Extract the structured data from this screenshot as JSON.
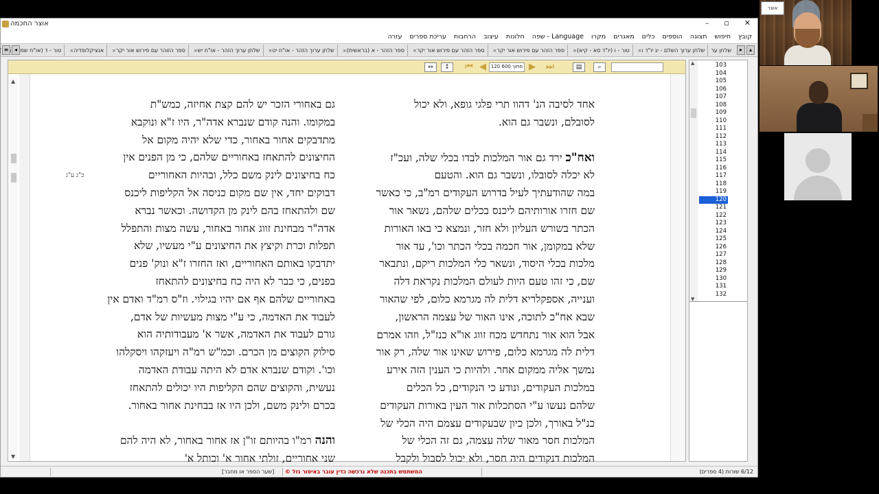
{
  "window": {
    "title": "אוצר החכמה",
    "minimize": "–",
    "restore": "▫",
    "close": "✕"
  },
  "menu": [
    "קובץ",
    "חיפוש",
    "תצוגה",
    "הוספים",
    "כלים",
    "מאגרים",
    "מקרו",
    "Language - שפה",
    "חלונות",
    "עיצוב",
    "הרחבות",
    "עריכת ספרים",
    "עזרה"
  ],
  "tabs": [
    "אנציקלופדיה",
    "ספר הזוהר עם פירוש אור יקר",
    "שלחן ערוך הזהר - או\"ח יש",
    "שלחן ערוך הזהר - או\"ח יט",
    "ספר הזהר - א (בראשית)",
    "ספר הזהר עם פירוש אור יקר",
    "ספר הזהר עם פירוש אור יקר",
    "טור - ו (יו\"ד סא - קיא)",
    "שלחן ערוך השלם - יג יו\"ד ו",
    "שלחן ער"
  ],
  "tabs_first": "טור - ד (או\"ח שמה - תצד)",
  "toolbar": {
    "page_field": "120 מתוך 600"
  },
  "text": {
    "right_column": [
      {
        "t": "אחד לסיבה הנ' דהוו תרי פלגי גופא, ולא יכול"
      },
      {
        "t": "לסובלם, ונשבר גם הוא."
      },
      {
        "t": ""
      },
      {
        "t": "ואח\"כ ירד גם אור המלכות לבדו בכלי שלה, ועכ\"ז",
        "lead": "ואח\"כ"
      },
      {
        "t": "לא יכלה לסובלו, ונשבר גם הוא. והטעם"
      },
      {
        "t": "במה שהודעתיך לעיל בדרוש העקודים רמ\"ב, כי כאשר"
      },
      {
        "t": "שם חזרו אורותיהם ליכנס בכלים שלהם, נשאר אור"
      },
      {
        "t": "הכתר בשורש העליון ולא חזר, ונמצא כי באו האורות"
      },
      {
        "t": "שלא במקומן, אור חכמה בכלי הכתר וכו', עד אור"
      },
      {
        "t": "מלכות בכלי היסוד, ונשאר כלי המלכות ריקם, ונתבאר"
      },
      {
        "t": "שם, כי זהו טעם היות לעולם המלכות נקראת דלה"
      },
      {
        "t": "וענייה, אספקלריא דלית לה מגרמא כלום, לפי שהאור"
      },
      {
        "t": "שבא אח\"כ לתוכה, אינו האור של עצמה הראשון,"
      },
      {
        "t": "אבל הוא אור נתחדש מכח זווג או\"א כנז\"ל, וזהו אמרם"
      },
      {
        "t": "דלית לה מגרמא כלום, פירוש שאינו אור שלה, רק אור"
      },
      {
        "t": "נמשך אליה ממקום אחר. ולהיות כי הענין הזה אירע"
      },
      {
        "t": "במלכות העקודים, ונודע כי הנקודים, כל הכלים"
      },
      {
        "t": "שלהם נעשו ע\"י הסתכלות אור העין באורות העקודים"
      },
      {
        "t": "כנ\"ל באורך, ולכן כיון שבעקודים עצמם היה הכלי של"
      },
      {
        "t": "המלכות חסר מאור שלה עצמה, גם זה הכלי של"
      },
      {
        "t": "המלכות דנקודים היה חסר, ולא יכול לסבול ולקבל"
      }
    ],
    "left_column": [
      {
        "t": "גם באחורי הזכר יש להם קצת אחיזה, כמש\"ת"
      },
      {
        "t": "במקומו. והנה קודם שנברא אדה\"ר, היו ז\"א ונוקבא"
      },
      {
        "t": "מתדבקים אחור באחור, כדי שלא יהיה מקום אל"
      },
      {
        "t": "החיצונים להתאחז באחוריים שלהם, כי מן הפנים אין"
      },
      {
        "t": "כח בחיצונים לינק משם כלל, ובהיות האחוריים"
      },
      {
        "t": "דבוקים יחד, אין שם מקום כניסה אל הקליפות ליכנס"
      },
      {
        "t": "שם ולהתאחז בהם לינק מן הקדושה. וכאשר נברא"
      },
      {
        "t": "אדה\"ר מבחינת זווג אחור באחור, עשה מצות והתפלל"
      },
      {
        "t": "תפלות וכרת וקיצץ את החיצונים ע\"י מעשיו, שלא"
      },
      {
        "t": "יתדבקו באותם האחוריים, ואז החזרו ז\"א ונוק' פנים"
      },
      {
        "t": "בפנים, כי כבר לא היה כח בחיצונים להתאחז"
      },
      {
        "t": "באחוריים שלהם אף אם יהיו בגילוי. וז\"ס רמ\"ד ואדם אין"
      },
      {
        "t": "לעבוד את האדמה, כי ע\"י מצות מעשיות של אדם,"
      },
      {
        "t": "גורם לעבוד את האדמה, אשר א' מעבודותיה הוא"
      },
      {
        "t": "סילוק הקוצים מן הכרם. וכמ\"ש רמ\"ה ויעזקהו ויסקלהו"
      },
      {
        "t": "וכו'. וקודם שנברא אדם לא היתה עבודת האדמה"
      },
      {
        "t": "נעשית, והקוצים שהם הקליפות היו יכולים להתאחז"
      },
      {
        "t": "בכרם ולינק משם, ולכן היו אז בבחינת אחור באחור."
      },
      {
        "t": ""
      },
      {
        "t": "והנה רמ\"ו בהיותם זו\"ן אז אחור באחור, לא היה להם",
        "lead": "והנה"
      },
      {
        "t": "שני אחוריים, זולתי אחור א' וכותל א'"
      }
    ],
    "margin_note": "כ\"ג ע\"ג"
  },
  "page_index": {
    "items": [
      "103",
      "104",
      "105",
      "106",
      "107",
      "108",
      "109",
      "110",
      "111",
      "112",
      "113",
      "114",
      "115",
      "116",
      "117",
      "118",
      "119",
      "120",
      "121",
      "122",
      "123",
      "124",
      "125",
      "126",
      "127",
      "128",
      "129",
      "130",
      "131",
      "132"
    ],
    "selected": "120"
  },
  "status": {
    "left_info": "6/12 שורות (4 ספרים)",
    "warning": "המשתמש בתכנה שלא נרכשה כדין עובר באיסור גזל",
    "copyright_mark": "©",
    "right_info": "[שער הספר או מחבר]"
  },
  "video": {
    "logo_text": "אוצר"
  }
}
